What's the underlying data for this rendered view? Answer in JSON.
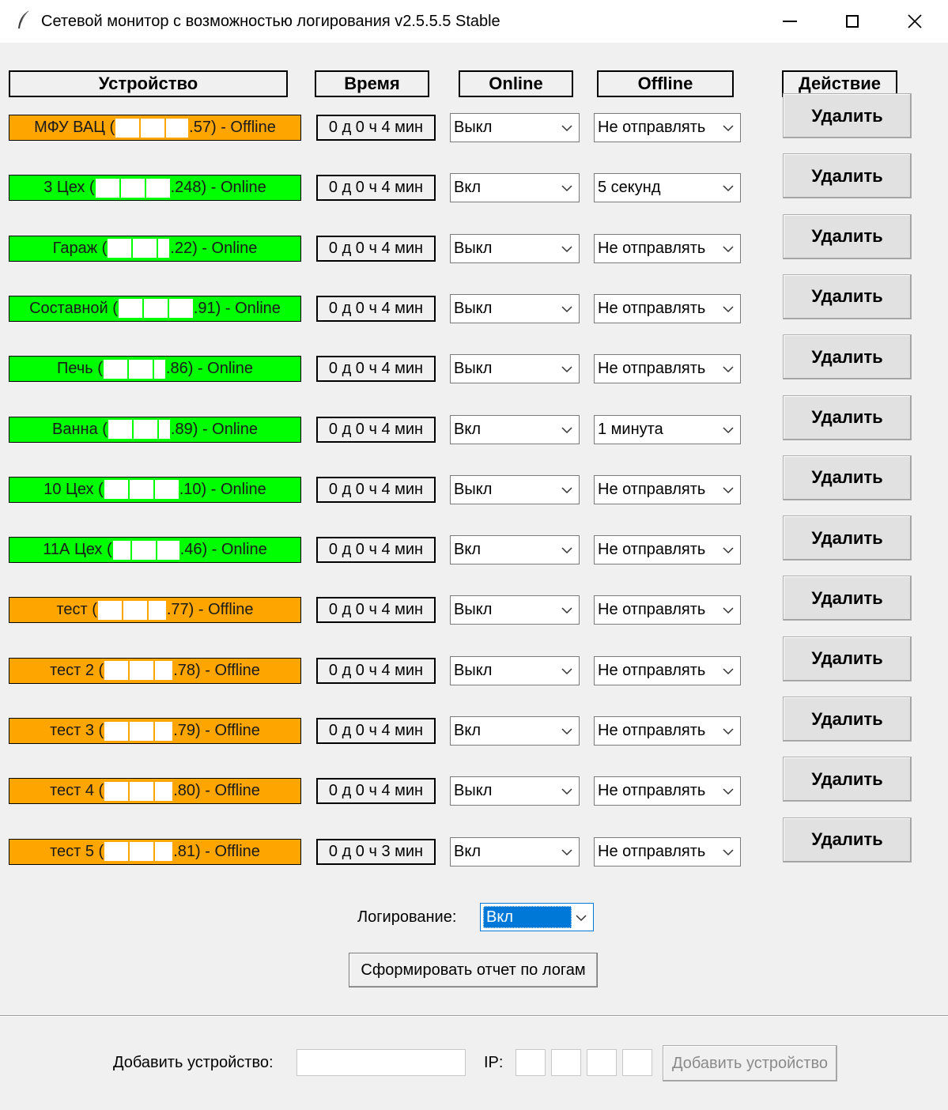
{
  "window": {
    "title": "Сетевой монитор с возможностью логирования v2.5.5.5 Stable"
  },
  "headers": {
    "device": "Устройство",
    "time": "Время",
    "online": "Online",
    "offline": "Offline",
    "action": "Действие"
  },
  "status_colors": {
    "online": "#00ff00",
    "offline": "#ffa500"
  },
  "devices": [
    {
      "prefix": "МФУ ВАЦ (",
      "suffix": ".57) - Offline",
      "status": "offline",
      "time": "0 д 0 ч 4 мин",
      "online_mode": "Выкл",
      "offline_mode": "Не отправлять",
      "delete_label": "Удалить"
    },
    {
      "prefix": "3 Цех (",
      "suffix": ".248) - Online",
      "status": "online",
      "time": "0 д 0 ч 4 мин",
      "online_mode": "Вкл",
      "offline_mode": "5 секунд",
      "delete_label": "Удалить"
    },
    {
      "prefix": "Гараж (",
      "suffix": ".22) - Online",
      "status": "online",
      "time": "0 д 0 ч 4 мин",
      "online_mode": "Выкл",
      "offline_mode": "Не отправлять",
      "delete_label": "Удалить"
    },
    {
      "prefix": "Составной (",
      "suffix": ".91) - Online",
      "status": "online",
      "time": "0 д 0 ч 4 мин",
      "online_mode": "Выкл",
      "offline_mode": "Не отправлять",
      "delete_label": "Удалить"
    },
    {
      "prefix": "Печь (",
      "suffix": ".86) - Online",
      "status": "online",
      "time": "0 д 0 ч 4 мин",
      "online_mode": "Выкл",
      "offline_mode": "Не отправлять",
      "delete_label": "Удалить"
    },
    {
      "prefix": "Ванна (",
      "suffix": ".89) - Online",
      "status": "online",
      "time": "0 д 0 ч 4 мин",
      "online_mode": "Вкл",
      "offline_mode": "1 минута",
      "delete_label": "Удалить"
    },
    {
      "prefix": "10 Цех (",
      "suffix": ".10) - Online",
      "status": "online",
      "time": "0 д 0 ч 4 мин",
      "online_mode": "Выкл",
      "offline_mode": "Не отправлять",
      "delete_label": "Удалить"
    },
    {
      "prefix": "11А Цех (",
      "suffix": ".46) - Online",
      "status": "online",
      "time": "0 д 0 ч 4 мин",
      "online_mode": "Вкл",
      "offline_mode": "Не отправлять",
      "delete_label": "Удалить"
    },
    {
      "prefix": "тест (",
      "suffix": ".77) - Offline",
      "status": "offline",
      "time": "0 д 0 ч 4 мин",
      "online_mode": "Выкл",
      "offline_mode": "Не отправлять",
      "delete_label": "Удалить"
    },
    {
      "prefix": "тест 2 (",
      "suffix": ".78) - Offline",
      "status": "offline",
      "time": "0 д 0 ч 4 мин",
      "online_mode": "Выкл",
      "offline_mode": "Не отправлять",
      "delete_label": "Удалить"
    },
    {
      "prefix": "тест 3 (",
      "suffix": ".79) - Offline",
      "status": "offline",
      "time": "0 д 0 ч 4 мин",
      "online_mode": "Вкл",
      "offline_mode": "Не отправлять",
      "delete_label": "Удалить"
    },
    {
      "prefix": "тест 4 (",
      "suffix": ".80) - Offline",
      "status": "offline",
      "time": "0 д 0 ч 4 мин",
      "online_mode": "Выкл",
      "offline_mode": "Не отправлять",
      "delete_label": "Удалить"
    },
    {
      "prefix": "тест 5 (",
      "suffix": ".81) - Offline",
      "status": "offline",
      "time": "0 д 0 ч 3 мин",
      "online_mode": "Вкл",
      "offline_mode": "Не отправлять",
      "delete_label": "Удалить"
    }
  ],
  "logging": {
    "label": "Логирование:",
    "value": "Вкл",
    "report_button": "Сформировать отчет по логам"
  },
  "add_device": {
    "label": "Добавить устройство:",
    "name_value": "",
    "ip_label": "IP:",
    "ip_octets": [
      "",
      "",
      "",
      ""
    ],
    "button": "Добавить устройство"
  }
}
